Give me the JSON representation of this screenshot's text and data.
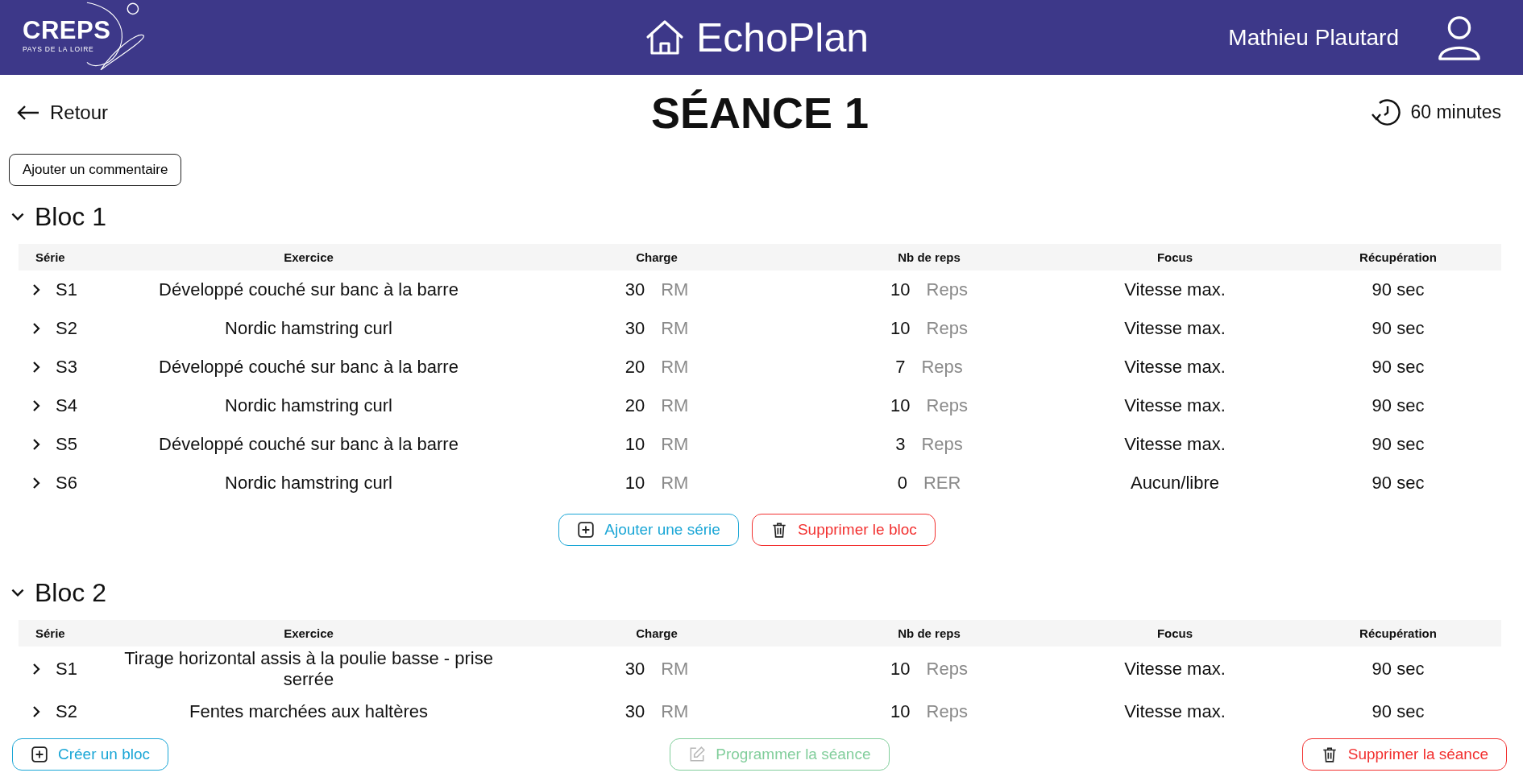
{
  "header": {
    "logo": {
      "name": "CREPS",
      "subtitle": "PAYS DE LA LOIRE"
    },
    "app_title": "EchoPlan",
    "user_name": "Mathieu Plautard"
  },
  "back_link": "Retour",
  "title": "SÉANCE 1",
  "duration": "60 minutes",
  "comment_button": "Ajouter un commentaire",
  "blocks": [
    {
      "title": "Bloc 1",
      "expanded": true,
      "columns": [
        "Série",
        "Exercice",
        "Charge",
        "Nb de reps",
        "Focus",
        "Récupération"
      ],
      "rows": [
        {
          "serie": "S1",
          "expanded": false,
          "exercise": "Développé couché sur banc à la barre",
          "charge": "30",
          "charge_unit": "RM",
          "reps": "10",
          "reps_unit": "Reps",
          "focus": "Vitesse max.",
          "recovery": "90 sec"
        },
        {
          "serie": "S2",
          "expanded": false,
          "exercise": "Nordic hamstring curl",
          "charge": "30",
          "charge_unit": "RM",
          "reps": "10",
          "reps_unit": "Reps",
          "focus": "Vitesse max.",
          "recovery": "90 sec"
        },
        {
          "serie": "S3",
          "expanded": false,
          "exercise": "Développé couché sur banc à la barre",
          "charge": "20",
          "charge_unit": "RM",
          "reps": "7",
          "reps_unit": "Reps",
          "focus": "Vitesse max.",
          "recovery": "90 sec"
        },
        {
          "serie": "S4",
          "expanded": false,
          "exercise": "Nordic hamstring curl",
          "charge": "20",
          "charge_unit": "RM",
          "reps": "10",
          "reps_unit": "Reps",
          "focus": "Vitesse max.",
          "recovery": "90 sec"
        },
        {
          "serie": "S5",
          "expanded": false,
          "exercise": "Développé couché sur banc à la barre",
          "charge": "10",
          "charge_unit": "RM",
          "reps": "3",
          "reps_unit": "Reps",
          "focus": "Vitesse max.",
          "recovery": "90 sec"
        },
        {
          "serie": "S6",
          "expanded": false,
          "exercise": "Nordic hamstring curl",
          "charge": "10",
          "charge_unit": "RM",
          "reps": "0",
          "reps_unit": "RER",
          "focus": "Aucun/libre",
          "recovery": "90 sec"
        }
      ],
      "actions": [
        {
          "kind": "add",
          "label": "Ajouter une série",
          "disabled": false
        },
        {
          "kind": "delete",
          "label": "Supprimer le bloc",
          "disabled": false
        }
      ]
    },
    {
      "title": "Bloc 2",
      "expanded": true,
      "columns": [
        "Série",
        "Exercice",
        "Charge",
        "Nb de reps",
        "Focus",
        "Récupération"
      ],
      "rows": [
        {
          "serie": "S1",
          "expanded": false,
          "exercise": "Tirage horizontal assis à la poulie basse - prise serrée",
          "charge": "30",
          "charge_unit": "RM",
          "reps": "10",
          "reps_unit": "Reps",
          "focus": "Vitesse max.",
          "recovery": "90 sec"
        },
        {
          "serie": "S2",
          "expanded": false,
          "exercise": "Fentes marchées aux haltères",
          "charge": "30",
          "charge_unit": "RM",
          "reps": "10",
          "reps_unit": "Reps",
          "focus": "Vitesse max.",
          "recovery": "90 sec"
        }
      ]
    }
  ],
  "footer": [
    {
      "kind": "add",
      "label": "Créer un bloc",
      "disabled": false
    },
    {
      "kind": "edit",
      "label": "Programmer la séance",
      "disabled": true
    },
    {
      "kind": "delete",
      "label": "Supprimer la séance",
      "disabled": false
    }
  ]
}
